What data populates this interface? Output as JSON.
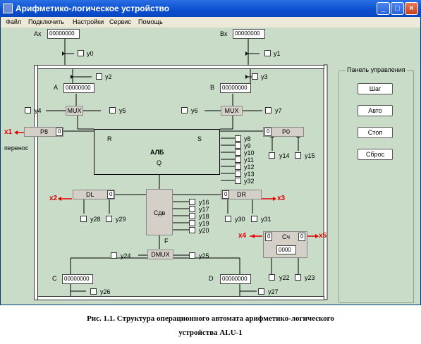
{
  "window": {
    "title": "Арифметико-логическое устройство"
  },
  "menu": [
    "Файл",
    "Подключить",
    "Настройки",
    "Сервис",
    "Помощь"
  ],
  "inputs": {
    "ax_label": "Ax",
    "ax_value": "00000000",
    "bx_label": "Bx",
    "bx_value": "00000000"
  },
  "registers": {
    "a_label": "A",
    "a_value": "00000000",
    "b_label": "B",
    "b_value": "00000000",
    "c_label": "C",
    "c_value": "00000000",
    "d_label": "D",
    "d_value": "00000000"
  },
  "signals": {
    "y0": "y0",
    "y1": "y1",
    "y2": "y2",
    "y3": "y3",
    "y4": "y4",
    "y5": "y5",
    "y6": "y6",
    "y7": "y7",
    "y8": "y8",
    "y9": "y9",
    "y10": "y10",
    "y11": "y11",
    "y12": "y12",
    "y13": "y13",
    "y32": "y32",
    "y14": "y14",
    "y15": "y15",
    "y16": "y16",
    "y17": "y17",
    "y18": "y18",
    "y19": "y19",
    "y20": "y20",
    "y22": "y22",
    "y23": "y23",
    "y24": "y24",
    "y25": "y25",
    "y26": "y26",
    "y27": "y27",
    "y28": "y28",
    "y29": "y29",
    "y30": "y30",
    "y31": "y31"
  },
  "blocks": {
    "mux": "MUX",
    "alu": "АЛБ",
    "alu_r": "R",
    "alu_s": "S",
    "alu_q": "Q",
    "p8": "P8",
    "p8_val": "0",
    "p0": "P0",
    "p0_val": "0",
    "carry": "перенос",
    "dl": "DL",
    "dl_val": "0",
    "dr": "DR",
    "dr_val": "0",
    "shift": "Сдв",
    "shift_f": "F",
    "dmux": "DMUX",
    "counter": "Сч",
    "counter_left": "0",
    "counter_right": "0",
    "counter_value": "0000"
  },
  "outputs": {
    "x1": "x1",
    "x2": "x2",
    "x3": "x3",
    "x4": "x4",
    "x5": "x5"
  },
  "panel": {
    "title": "Панель управления",
    "step": "Шаг",
    "auto": "Авто",
    "stop": "Стоп",
    "reset": "Сброс"
  },
  "caption": {
    "line1": "Рис. 1.1. Структура  операционного автомата арифметико-логического",
    "line2": "устройства ALU-1"
  }
}
